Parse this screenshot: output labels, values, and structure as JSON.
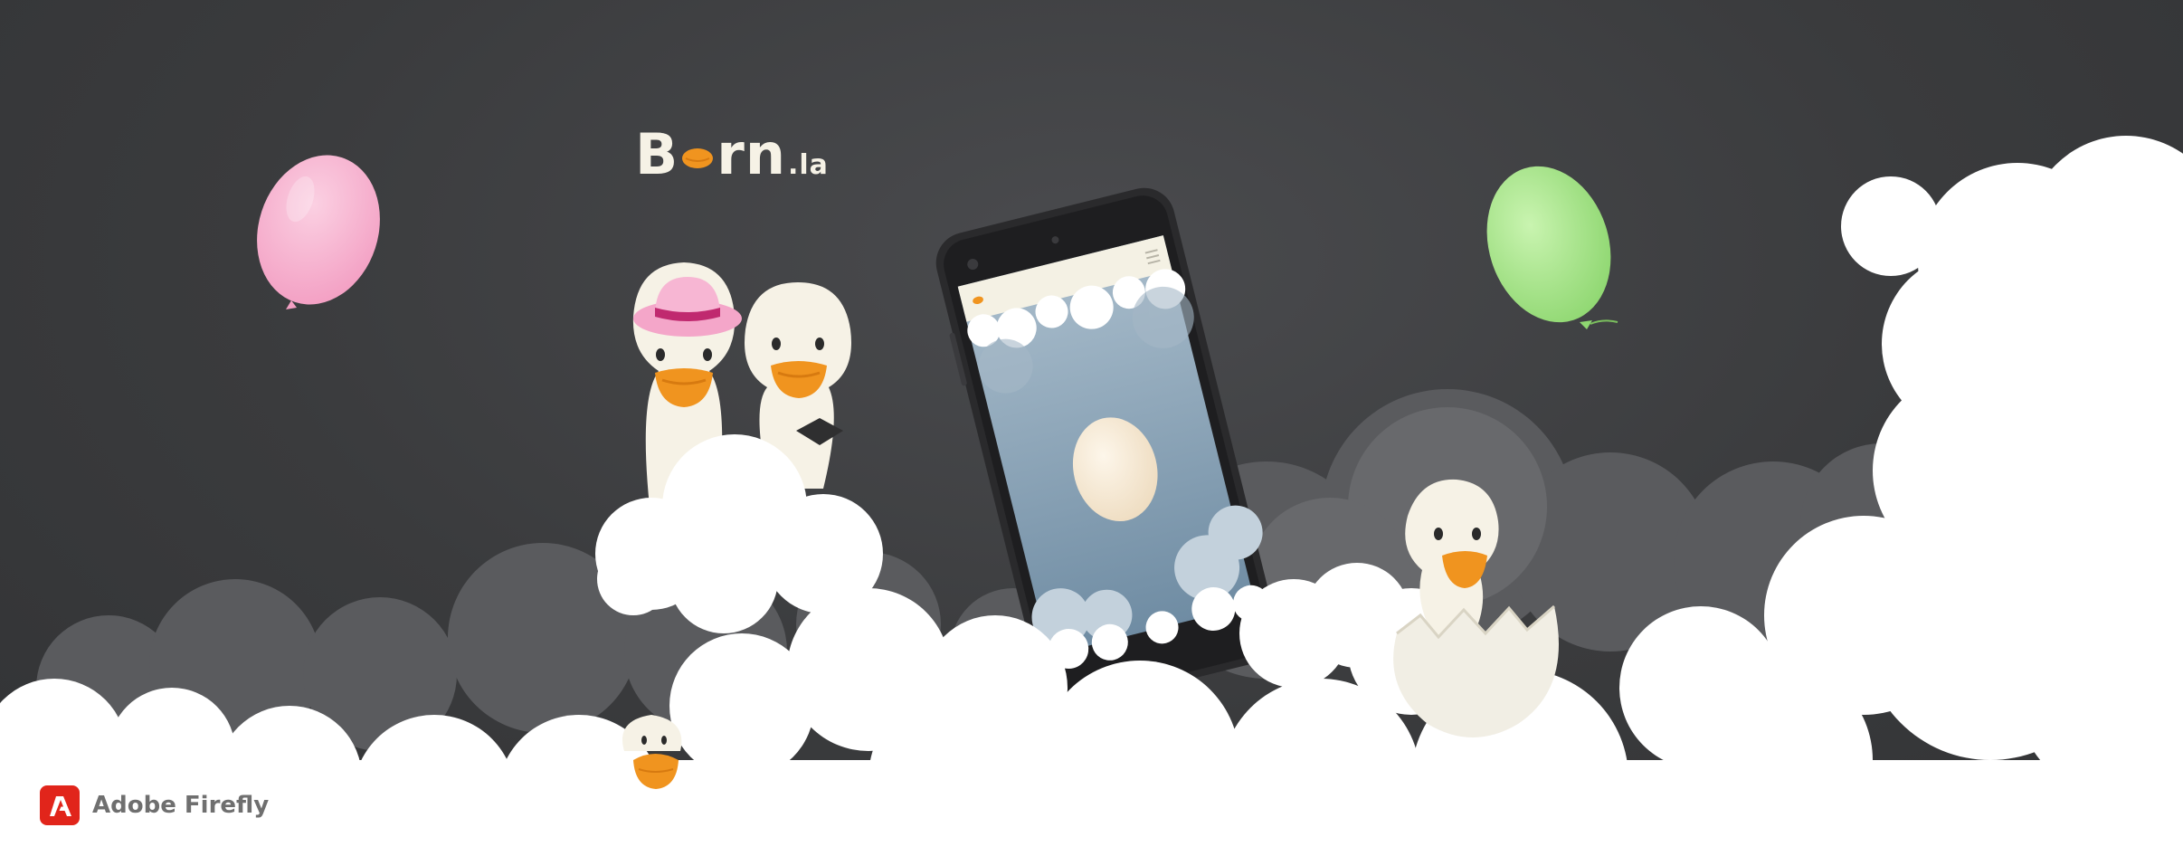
{
  "brand": {
    "logo_first": "B",
    "logo_rest": "rn",
    "logo_suffix": ".la",
    "logo_color": "#f6f2e6",
    "beak_color": "#f0941f"
  },
  "watermark": {
    "label": "Adobe Firefly",
    "icon": "adobe-firefly-icon",
    "icon_color": "#e1251b"
  },
  "palette": {
    "background": "#3b3c3e",
    "cloud": "#ffffff",
    "cloud_shadow": "#5c5d60",
    "pink_balloon": "#f7b3cf",
    "green_balloon": "#a6e58a",
    "duck_body": "#f6f2e6",
    "beak": "#f0941f",
    "hat": "#f4a6c9",
    "hat_band": "#c0296f",
    "phone_body": "#2a2a2c",
    "phone_sky": "#8aa3b5",
    "egg": "#f8ecd9"
  }
}
